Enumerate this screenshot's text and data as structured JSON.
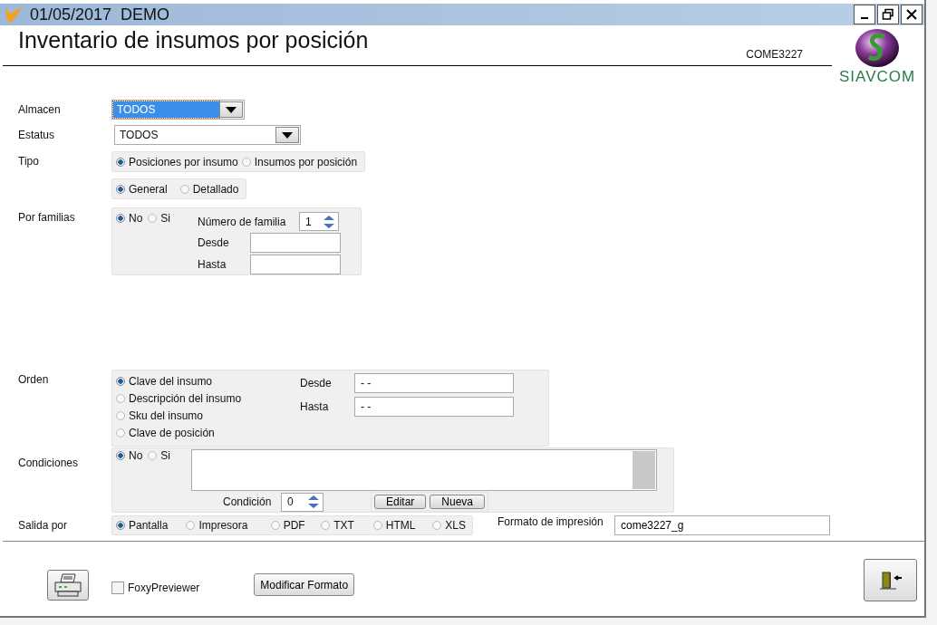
{
  "window": {
    "title": "01/05/2017  DEMO"
  },
  "header": {
    "title": "Inventario de insumos por posición",
    "code": "COME3227",
    "logo_text": "SIAVCOM"
  },
  "almacen": {
    "label": "Almacen",
    "value": "TODOS",
    "focused": true
  },
  "estatus": {
    "label": "Estatus",
    "value": "TODOS",
    "focused": false
  },
  "tipo": {
    "label": "Tipo",
    "groups": [
      {
        "options": [
          {
            "label": "Posiciones por insumo",
            "selected": true
          },
          {
            "label": "Insumos por posición",
            "selected": false
          }
        ]
      },
      {
        "options": [
          {
            "label": "General",
            "selected": true
          },
          {
            "label": "Detallado",
            "selected": false
          }
        ]
      }
    ]
  },
  "familias": {
    "label": "Por familias",
    "options": [
      {
        "label": "No",
        "selected": true
      },
      {
        "label": "Si",
        "selected": false
      }
    ],
    "numero_label": "Número de familia",
    "numero_value": "1",
    "desde_label": "Desde",
    "hasta_label": "Hasta"
  },
  "orden": {
    "label": "Orden",
    "options": [
      {
        "label": "Clave del insumo",
        "selected": true
      },
      {
        "label": "Descripción del insumo",
        "selected": false
      },
      {
        "label": "Sku del insumo",
        "selected": false
      },
      {
        "label": "Clave de posición",
        "selected": false
      }
    ],
    "desde_label": "Desde",
    "desde_value": "- -",
    "hasta_label": "Hasta",
    "hasta_value": "- -"
  },
  "condiciones": {
    "label": "Condiciones",
    "options": [
      {
        "label": "No",
        "selected": true
      },
      {
        "label": "Si",
        "selected": false
      }
    ],
    "condicion_label": "Condición",
    "condicion_value": "0",
    "buttons": [
      "Editar",
      "Nueva"
    ]
  },
  "salida": {
    "label": "Salida por",
    "options": [
      {
        "label": "Pantalla",
        "selected": true
      },
      {
        "label": "Impresora",
        "selected": false
      },
      {
        "label": "PDF",
        "selected": false
      },
      {
        "label": "TXT",
        "selected": false
      },
      {
        "label": "HTML",
        "selected": false
      },
      {
        "label": "XLS",
        "selected": false
      }
    ],
    "formato_label": "Formato de impresión",
    "formato_value": "come3227_g"
  },
  "footer": {
    "foxy": {
      "label": "FoxyPreviewer",
      "checked": false
    },
    "modify_button": "Modificar Formato"
  }
}
